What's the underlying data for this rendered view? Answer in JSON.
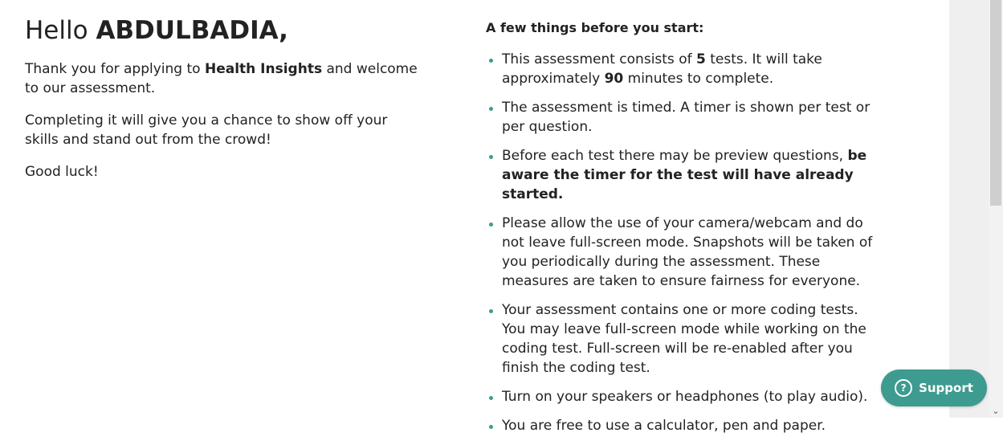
{
  "greeting": {
    "hello": "Hello",
    "name": "ABDULBADIA,"
  },
  "intro": {
    "p1_before": "Thank you for applying to ",
    "company": "Health Insights",
    "p1_after": " and welcome to our assessment.",
    "p2": "Completing it will give you a chance to show off your skills and stand out from the crowd!",
    "p3": "Good luck!"
  },
  "rules": {
    "heading": "A few things before you start:",
    "r1_a": "This assessment consists of ",
    "r1_b": "5",
    "r1_c": " tests. It will take approximately ",
    "r1_d": "90",
    "r1_e": " minutes to complete.",
    "r2": "The assessment is timed. A timer is shown per test or per question.",
    "r3_a": "Before each test there may be preview questions, ",
    "r3_b": "be aware the timer for the test will have already started.",
    "r4": "Please allow the use of your camera/webcam and do not leave full-screen mode. Snapshots will be taken of you periodically during the assessment. These measures are taken to ensure fairness for everyone.",
    "r5": "Your assessment contains one or more coding tests. You may leave full-screen mode while working on the coding test. Full-screen will be re-enabled after you finish the coding test.",
    "r6": "Turn on your speakers or headphones (to play audio).",
    "r7": "You are free to use a calculator, pen and paper."
  },
  "support": {
    "label": "Support",
    "icon": "?"
  },
  "colors": {
    "accent": "#3d9b8f"
  }
}
